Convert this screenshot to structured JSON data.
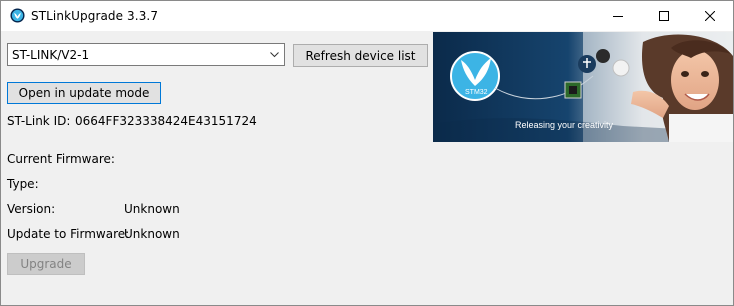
{
  "window": {
    "title": "STLinkUpgrade 3.3.7",
    "minimize_icon": "minimize-icon",
    "maximize_icon": "maximize-icon",
    "close_icon": "close-icon"
  },
  "device": {
    "selected": "ST-LINK/V2-1",
    "refresh_label": "Refresh device list",
    "open_update_label": "Open in update mode",
    "stlink_id_label": "ST-Link ID:",
    "stlink_id_value": "0664FF323338424E43151724"
  },
  "firmware": {
    "current_label": "Current Firmware:",
    "type_label": "Type:",
    "version_label": "Version:",
    "version_value": "Unknown",
    "update_label": "Update to Firmware:",
    "update_value": "Unknown",
    "upgrade_label": "Upgrade"
  },
  "banner": {
    "brand": "STM32",
    "tagline": "Releasing your creativity"
  },
  "colors": {
    "banner_bg": "#0b2a4a",
    "brand_blue": "#3cb4e5",
    "focus_border": "#0078d7"
  }
}
